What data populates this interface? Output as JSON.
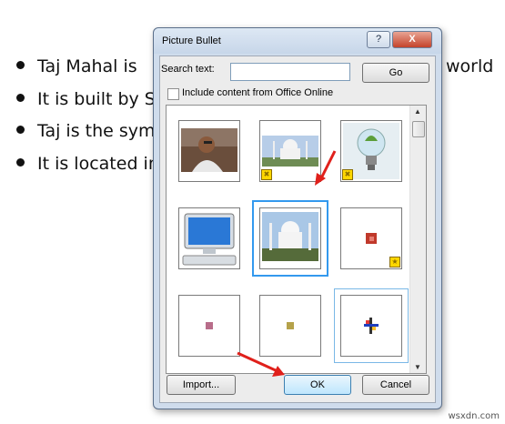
{
  "document": {
    "lines": [
      "Taj Mahal is",
      "It is built by S",
      "Taj is the sym",
      "It is located in"
    ],
    "tail_word": "world"
  },
  "dialog": {
    "title": "Picture Bullet",
    "help_label": "?",
    "close_label": "X",
    "search_label": "Search text:",
    "search_value": "",
    "go_label": "Go",
    "include_label": "Include content from Office Online",
    "include_checked": false,
    "import_label": "Import...",
    "ok_label": "OK",
    "cancel_label": "Cancel"
  },
  "pictures": [
    {
      "icon": "person-photo-icon"
    },
    {
      "icon": "taj-mahal-small-icon",
      "badge": "online"
    },
    {
      "icon": "lightbulb-plant-icon",
      "badge": "online"
    },
    {
      "icon": "computer-monitor-icon"
    },
    {
      "icon": "taj-mahal-selected-icon",
      "selected": true
    },
    {
      "icon": "red-square-bullet-icon",
      "badge": "star"
    },
    {
      "icon": "pink-square-bullet-icon"
    },
    {
      "icon": "yellow-square-bullet-icon"
    },
    {
      "icon": "cross-bullet-icon",
      "hover": true
    }
  ],
  "colors": {
    "annotation_arrow": "#e0201b",
    "selection": "#3399ee"
  },
  "watermark": "wsxdn.com"
}
